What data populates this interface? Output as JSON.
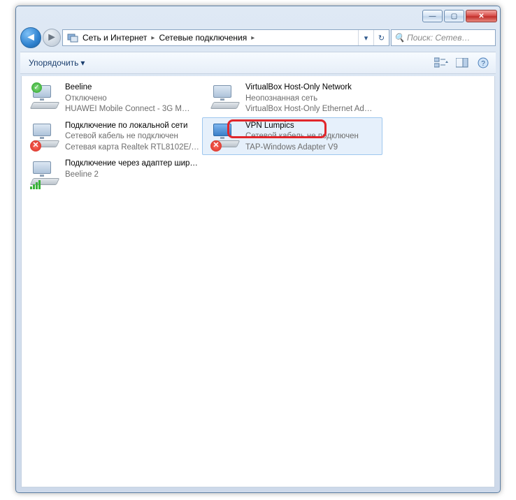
{
  "window": {
    "minimize": "—",
    "maximize": "▢",
    "close": "✕"
  },
  "nav": {
    "back": "◄",
    "forward": "►"
  },
  "breadcrumb": {
    "seg1": "Сеть и Интернет",
    "seg2": "Сетевые подключения",
    "arrow": "▸",
    "dropdown": "▾",
    "refresh": "↻"
  },
  "search": {
    "placeholder": "Поиск: Сетев…",
    "icon": "🔍"
  },
  "toolbar": {
    "organize": "Упорядочить",
    "caret": "▾"
  },
  "items": [
    {
      "name": "Beeline",
      "sub1": "Отключено",
      "sub2": "HUAWEI Mobile Connect - 3G M…",
      "overlay": "green"
    },
    {
      "name": "VirtualBox Host-Only Network",
      "sub1": "Неопознанная сеть",
      "sub2": "VirtualBox Host-Only Ethernet Ad…",
      "overlay": "none"
    },
    {
      "name": "Подключение по локальной сети",
      "sub1": "Сетевой кабель не подключен",
      "sub2": "Сетевая карта Realtek RTL8102E/…",
      "overlay": "redx"
    },
    {
      "name": "VPN Lumpics",
      "sub1": "Сетевой кабель не подключен",
      "sub2": "TAP-Windows Adapter V9",
      "overlay": "redx",
      "selected": true,
      "blue": true
    },
    {
      "name": "Подключение через адаптер широкополосной мобильной с…",
      "sub1": "Beeline  2",
      "sub2": "",
      "overlay": "bars"
    }
  ]
}
